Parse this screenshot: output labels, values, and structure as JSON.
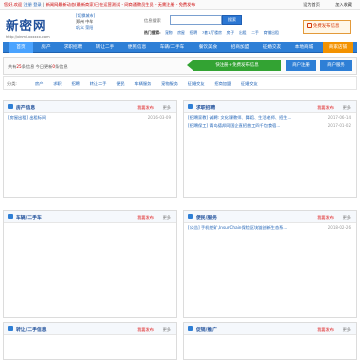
{
  "topbar": {
    "left_links": [
      "您好,",
      "欢迎",
      "注册",
      "登录",
      "|",
      "新闻网最新动态(最新商家)已在运营测试 - 网商通教员生员 - 无需注册 - 免费发布"
    ],
    "right_links": [
      "设为首页",
      "加入收藏"
    ]
  },
  "logo": {
    "name": "新密网",
    "url": "http://xinmi.xxxxxx.com"
  },
  "city": {
    "switch_label": "[切换城市]",
    "city1": "郑州 中牟",
    "city2": "巩义 荥阳"
  },
  "search": {
    "label": "信息搜索",
    "placeholder": "",
    "button": "搜索"
  },
  "hot": {
    "label": "热门搜索:",
    "keywords": [
      "宠物",
      "房屋",
      "招聘",
      "7套1厅楼房",
      "房子",
      "出租",
      "二手",
      "商铺出租"
    ]
  },
  "free_post": "免费发布信息",
  "nav": {
    "items": [
      "首页",
      "房产",
      "求职招聘",
      "转让二手",
      "便民信息",
      "车辆/二手车",
      "餐饮美食",
      "招商加盟",
      "征婚交友",
      "本地商城",
      "商家店铺"
    ]
  },
  "adbar": {
    "text_prefix": "共有",
    "count": "25",
    "text_mid": "条信息 今日更新",
    "today": "0",
    "text_suffix": "条信息",
    "arrow_button": "快注册+免费发布信息",
    "reg_button": "商户注册",
    "svc_button": "商户服务"
  },
  "cats": {
    "label": "分类:",
    "links": [
      "房产",
      "求职",
      "招聘",
      "转让二手",
      "便民",
      "车辆服务",
      "宠物服务",
      "征婚交友",
      "招商加盟",
      "征婚交友"
    ]
  },
  "panels": [
    {
      "title": "房产信息",
      "post": "我要发布",
      "more": "更多",
      "rows": [
        {
          "text": "[房屋出租] 出租标间",
          "date": "2016-03-09"
        }
      ]
    },
    {
      "title": "求职招聘",
      "post": "我要发布",
      "more": "更多",
      "rows": [
        {
          "text": "[招聘家教] 诚聘: 文化课教师、舞蹈、生活老师、招生...",
          "date": "2017-06-14"
        },
        {
          "text": "[招聘保工] 青岛德邦同国企直招普工四千包食宿...",
          "date": "2017-01-02"
        }
      ]
    },
    {
      "title": "车辆/二手车",
      "post": "我要发布",
      "more": "更多",
      "rows": []
    },
    {
      "title": "便民/服务",
      "post": "我要发布",
      "more": "更多",
      "rows": [
        {
          "text": "[公告] 手机挖矿,InsurChain保险区块链创新生态系...",
          "date": "2018-02-26"
        }
      ]
    },
    {
      "title": "转让/二手信息",
      "post": "我要发布",
      "more": "更多",
      "rows": []
    },
    {
      "title": "促销/推广",
      "post": "我要发布",
      "more": "更多",
      "rows": []
    }
  ]
}
